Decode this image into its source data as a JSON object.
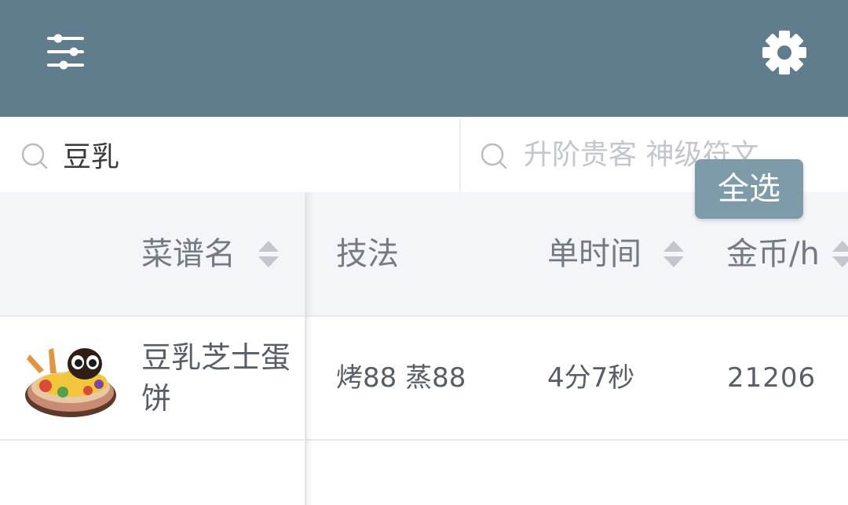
{
  "header": {
    "filter_icon": "sliders-icon",
    "settings_icon": "gear-icon",
    "bg_color": "#5f7d8c"
  },
  "search": {
    "left_value": "豆乳",
    "right_placeholder": "升阶贵客 神级符文",
    "select_all_label": "全选"
  },
  "table": {
    "columns": [
      {
        "label": "菜谱名",
        "sortable": true
      },
      {
        "label": "技法",
        "sortable": false
      },
      {
        "label": "单时间",
        "sortable": true
      },
      {
        "label": "金币/h",
        "sortable": true
      }
    ],
    "rows": [
      {
        "image_icon": "dish-thumbnail",
        "name": "豆乳芝士蛋饼",
        "skills": "烤88 蒸88",
        "time": "4分7秒",
        "gold_per_hour": "21206"
      }
    ]
  }
}
